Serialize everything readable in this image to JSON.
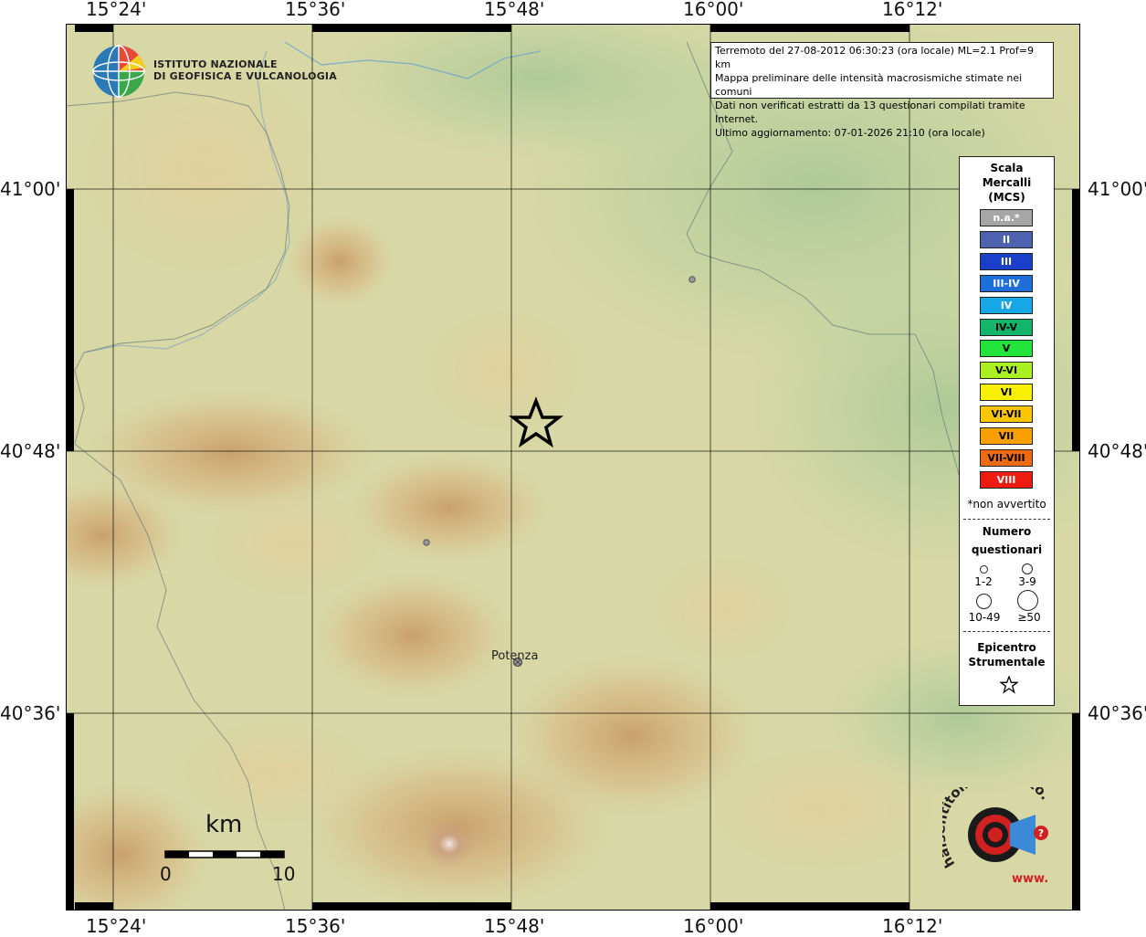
{
  "info": {
    "line1": "Terremoto del 27-08-2012 06:30:23 (ora locale) ML=2.1 Prof=9 km",
    "line2": "Mappa preliminare delle intensità macrosismiche stimate nei comuni",
    "line3": "Dati non verificati estratti da 13 questionari compilati tramite Internet.",
    "line4": "Ultimo aggiornamento: 07-01-2026 21:10 (ora locale)"
  },
  "logo": {
    "ingv_line1": "ISTITUTO NAZIONALE",
    "ingv_line2": "DI GEOFISICA E VULCANOLOGIA",
    "hsit_text": "haisentitoilterremoto.it",
    "hsit_www": "www."
  },
  "axes": {
    "top_labels": [
      "15°24'",
      "15°36'",
      "15°48'",
      "16°00'",
      "16°12'"
    ],
    "bottom_labels": [
      "15°24'",
      "15°36'",
      "15°48'",
      "16°00'",
      "16°12'"
    ],
    "left_labels": [
      "41°00'",
      "40°48'",
      "40°36'"
    ],
    "right_labels": [
      "41°00'",
      "40°48'",
      "40°36'"
    ]
  },
  "legend": {
    "title1": "Scala",
    "title2": "Mercalli",
    "title3": "(MCS)",
    "scale": [
      {
        "label": "n.a.*",
        "color": "#a6a6a6",
        "text_color": "#ffffff"
      },
      {
        "label": "II",
        "color": "#4d63b0",
        "text_color": "#ffffff"
      },
      {
        "label": "III",
        "color": "#1a3fc8",
        "text_color": "#ffffff"
      },
      {
        "label": "III-IV",
        "color": "#1e6fd9",
        "text_color": "#ffffff"
      },
      {
        "label": "IV",
        "color": "#18a7e6",
        "text_color": "#ffffff"
      },
      {
        "label": "IV-V",
        "color": "#12b56a",
        "text_color": "#000000"
      },
      {
        "label": "V",
        "color": "#22e43a",
        "text_color": "#000000"
      },
      {
        "label": "V-VI",
        "color": "#aaf020",
        "text_color": "#000000"
      },
      {
        "label": "VI",
        "color": "#f8f000",
        "text_color": "#000000"
      },
      {
        "label": "VI-VII",
        "color": "#fbc500",
        "text_color": "#000000"
      },
      {
        "label": "VII",
        "color": "#f7a000",
        "text_color": "#000000"
      },
      {
        "label": "VII-VIII",
        "color": "#f06a10",
        "text_color": "#000000"
      },
      {
        "label": "VIII",
        "color": "#ee1c10",
        "text_color": "#ffffff"
      }
    ],
    "not_felt_note": "*non avvertito",
    "count_title1": "Numero",
    "count_title2": "questionari",
    "count_1": "1-2",
    "count_2": "3-9",
    "count_3": "10-49",
    "count_4": "≥50",
    "epicenter_title1": "Epicentro",
    "epicenter_title2": "Strumentale"
  },
  "town": {
    "name": "Potenza"
  },
  "scale_bar": {
    "unit": "km",
    "start": "0",
    "end": "10"
  },
  "colors": {
    "terrain_base": "#d6d9a4",
    "frame": "#000000",
    "grid": "#000000"
  }
}
